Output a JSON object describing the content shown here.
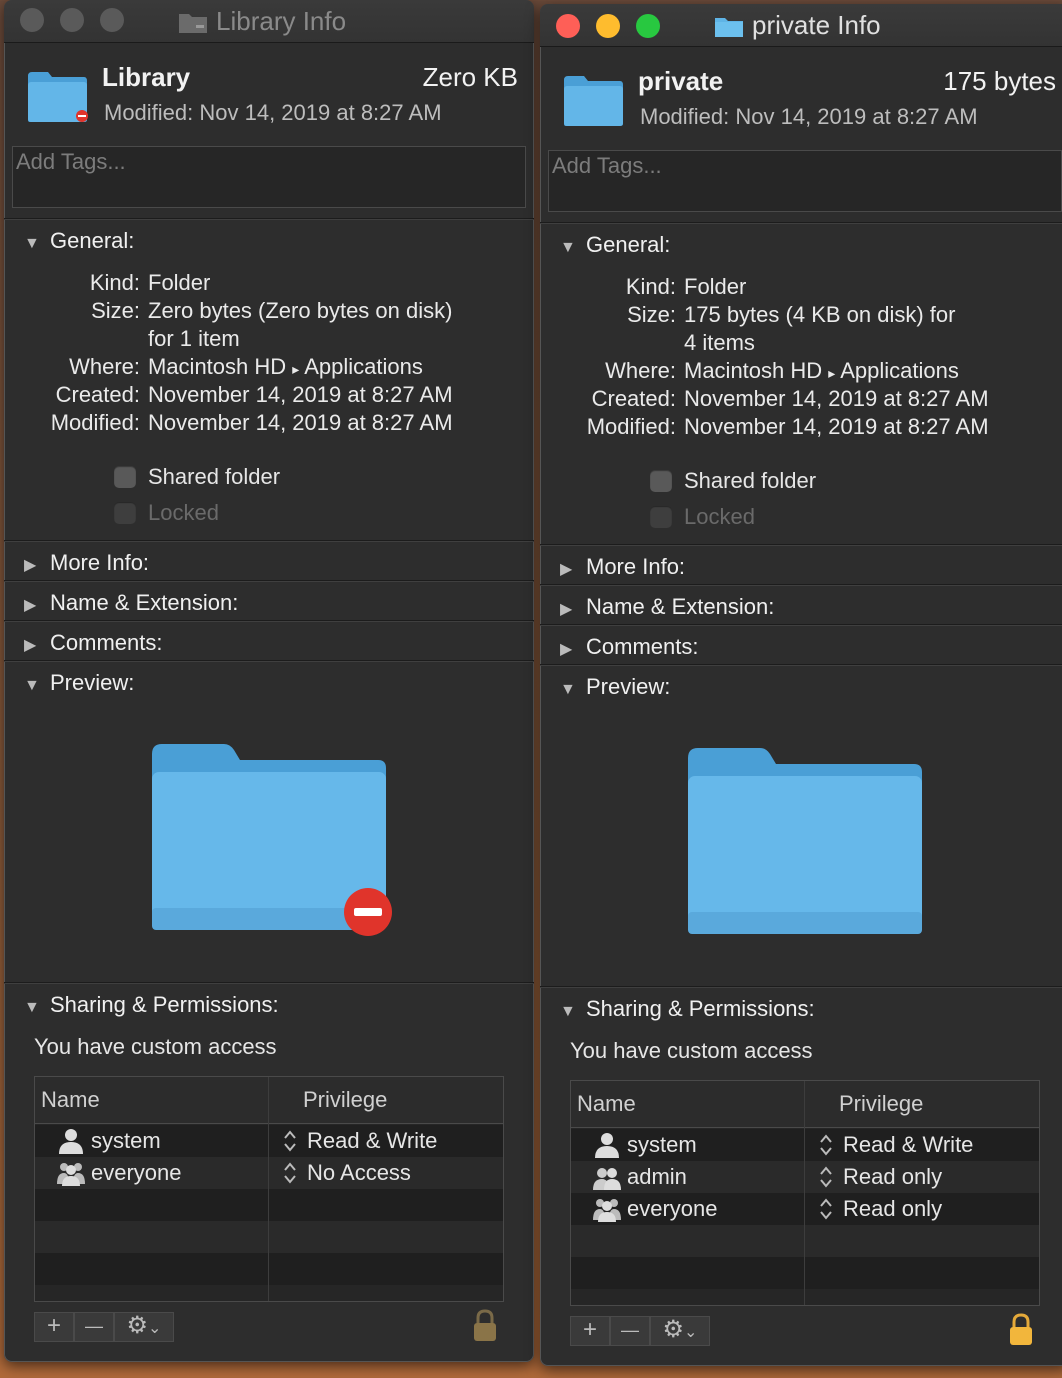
{
  "colors": {
    "window_bg": "#2d2d2d",
    "folder_blue": "#5fb4e6",
    "lock_gold": "#e4a93a",
    "close_red": "#fe5f57",
    "min_yellow": "#febc2e",
    "zoom_green": "#28c840"
  },
  "left": {
    "title": "Library Info",
    "name": "Library",
    "size": "Zero KB",
    "modified": "Modified: Nov 14, 2019 at 8:27 AM",
    "tags_placeholder": "Add Tags...",
    "general_label": "General:",
    "kind_label": "Kind:",
    "kind": "Folder",
    "size_label": "Size:",
    "size_line1": "Zero bytes (Zero bytes on disk)",
    "size_line2": "for 1 item",
    "where_label": "Where:",
    "where_a": "Macintosh HD",
    "where_sep": "▸",
    "where_b": "Applications",
    "created_label": "Created:",
    "created": "November 14, 2019 at 8:27 AM",
    "modified_label": "Modified:",
    "modified_full": "November 14, 2019 at 8:27 AM",
    "shared": "Shared folder",
    "locked": "Locked",
    "more_info": "More Info:",
    "name_ext": "Name & Extension:",
    "comments": "Comments:",
    "preview": "Preview:",
    "sharing": "Sharing & Permissions:",
    "custom": "You have custom access",
    "col_name": "Name",
    "col_priv": "Privilege",
    "users": [
      {
        "name": "system",
        "priv": "Read & Write",
        "icon": "single-user-icon"
      },
      {
        "name": "everyone",
        "priv": "No Access",
        "icon": "group-users-icon"
      }
    ],
    "plus": "+",
    "minus": "—",
    "gear": "⚙",
    "chev": "⌄"
  },
  "right": {
    "title": "private Info",
    "name": "private",
    "size": "175 bytes",
    "modified": "Modified: Nov 14, 2019 at 8:27 AM",
    "tags_placeholder": "Add Tags...",
    "general_label": "General:",
    "kind_label": "Kind:",
    "kind": "Folder",
    "size_label": "Size:",
    "size_line1": "175 bytes (4 KB on disk) for",
    "size_line2": "4 items",
    "where_label": "Where:",
    "where_a": "Macintosh HD",
    "where_sep": "▸",
    "where_b": "Applications",
    "created_label": "Created:",
    "created": "November 14, 2019 at 8:27 AM",
    "modified_label": "Modified:",
    "modified_full": "November 14, 2019 at 8:27 AM",
    "shared": "Shared folder",
    "locked": "Locked",
    "more_info": "More Info:",
    "name_ext": "Name & Extension:",
    "comments": "Comments:",
    "preview": "Preview:",
    "sharing": "Sharing & Permissions:",
    "custom": "You have custom access",
    "col_name": "Name",
    "col_priv": "Privilege",
    "users": [
      {
        "name": "system",
        "priv": "Read & Write",
        "icon": "single-user-icon"
      },
      {
        "name": "admin",
        "priv": "Read only",
        "icon": "two-users-icon"
      },
      {
        "name": "everyone",
        "priv": "Read only",
        "icon": "group-users-icon"
      }
    ],
    "plus": "+",
    "minus": "—",
    "gear": "⚙",
    "chev": "⌄"
  }
}
